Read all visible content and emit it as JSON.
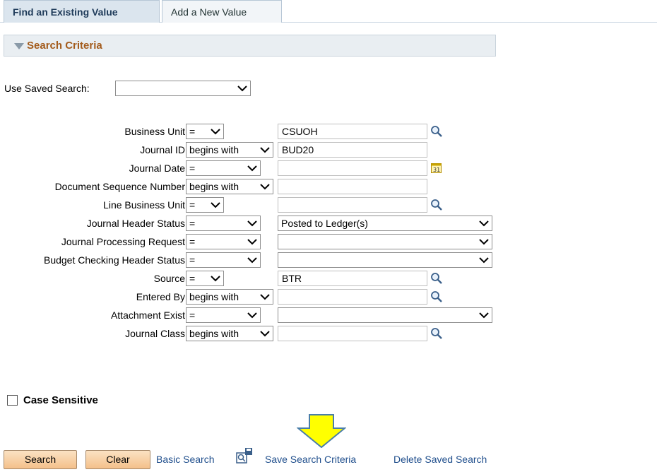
{
  "tabs": [
    {
      "label": "Find an Existing Value",
      "active": true
    },
    {
      "label": "Add a New Value",
      "active": false
    }
  ],
  "group": {
    "title": "Search Criteria"
  },
  "saved_search": {
    "label": "Use Saved Search:",
    "value": ""
  },
  "fields": [
    {
      "label": "Business Unit",
      "operator": "=",
      "value": "CSUOH",
      "value_type": "text-lookup"
    },
    {
      "label": "Journal ID",
      "operator": "begins with",
      "value": "BUD20",
      "value_type": "text"
    },
    {
      "label": "Journal Date",
      "operator": "=",
      "value": "",
      "value_type": "date"
    },
    {
      "label": "Document Sequence Number",
      "operator": "begins with",
      "value": "",
      "value_type": "text"
    },
    {
      "label": "Line Business Unit",
      "operator": "=",
      "value": "",
      "value_type": "text-lookup"
    },
    {
      "label": "Journal Header Status",
      "operator": "=",
      "value": "Posted to Ledger(s)",
      "value_type": "select"
    },
    {
      "label": "Journal Processing Request",
      "operator": "=",
      "value": "",
      "value_type": "select"
    },
    {
      "label": "Budget Checking Header Status",
      "operator": "=",
      "value": "",
      "value_type": "select"
    },
    {
      "label": "Source",
      "operator": "=",
      "value": "BTR",
      "value_type": "text-lookup"
    },
    {
      "label": "Entered By",
      "operator": "begins with",
      "value": "",
      "value_type": "text-lookup"
    },
    {
      "label": "Attachment Exist",
      "operator": "=",
      "value": "",
      "value_type": "select"
    },
    {
      "label": "Journal Class",
      "operator": "begins with",
      "value": "",
      "value_type": "text-lookup"
    }
  ],
  "case_sensitive": {
    "label": "Case Sensitive",
    "checked": false
  },
  "buttons": {
    "search": "Search",
    "clear": "Clear"
  },
  "links": {
    "basic_search": "Basic Search",
    "save_search_criteria": "Save Search Criteria",
    "delete_saved_search": "Delete Saved Search"
  },
  "icons": {
    "lookup": "magnifier-icon",
    "calendar": "calendar-icon",
    "save_search": "save-search-icon",
    "arrow": "down-arrow-annotation"
  },
  "colors": {
    "accent_orange": "#a35b1c",
    "link_blue": "#1f4e8c",
    "arrow_yellow": "#ffff00"
  }
}
